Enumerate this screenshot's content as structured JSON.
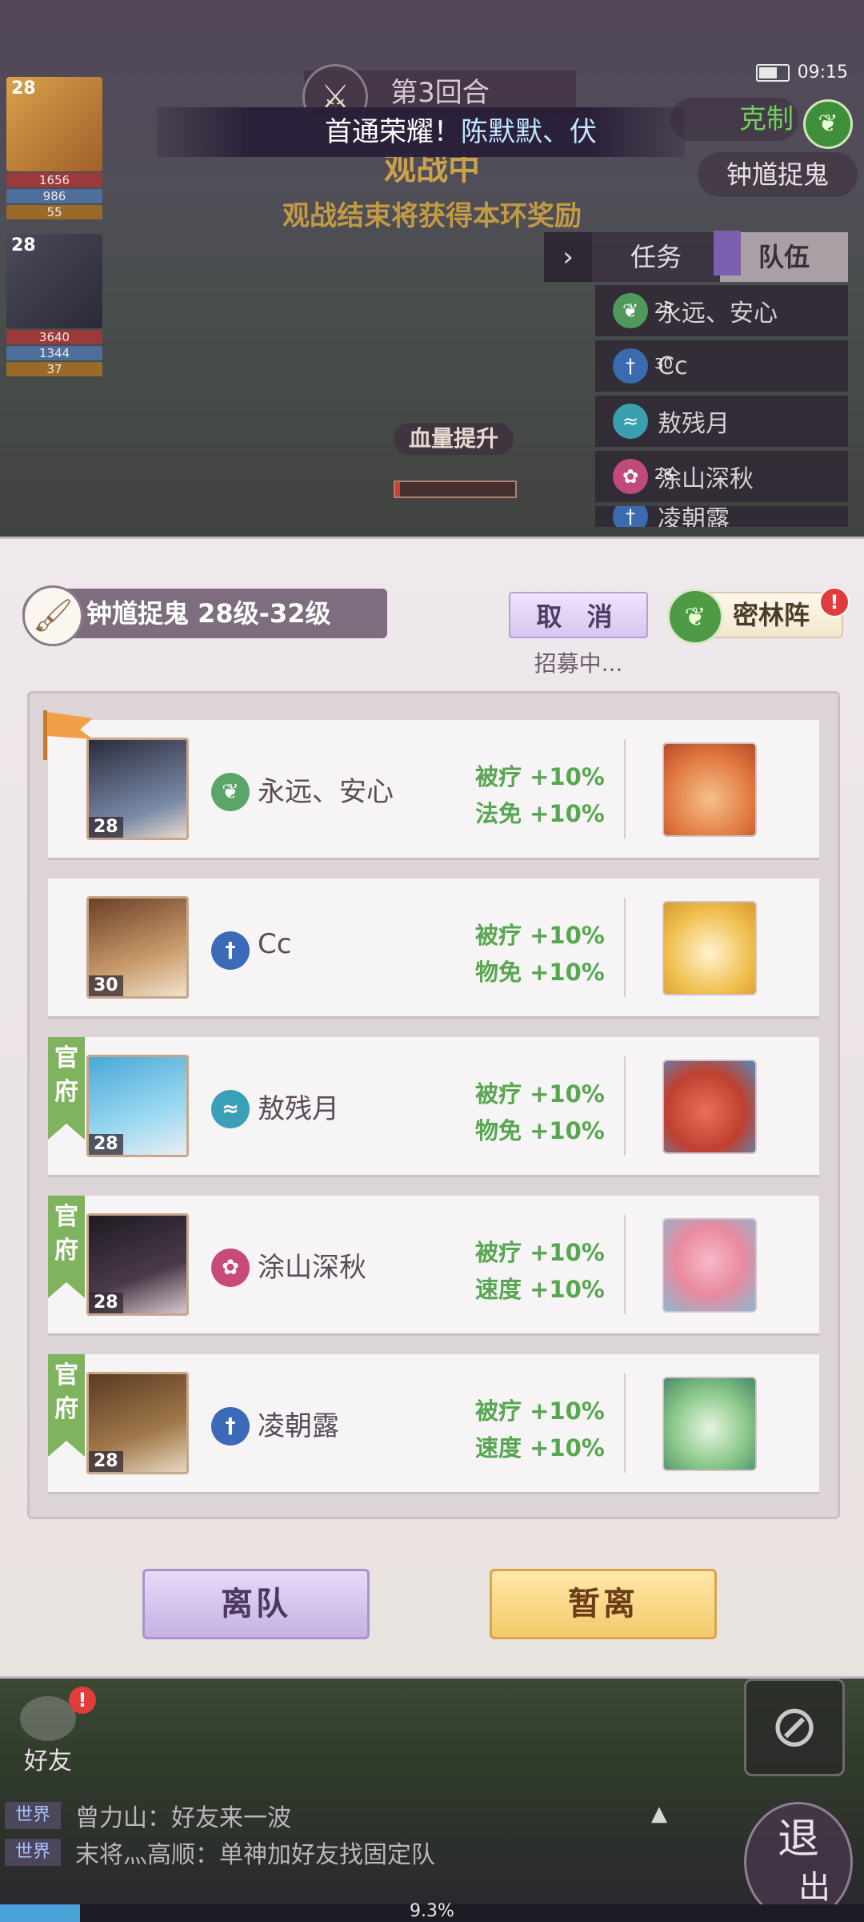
{
  "status": {
    "time": "09:15"
  },
  "battle": {
    "round": "第3回合",
    "honor_prefix": "首通荣耀！",
    "honor_names": "陈默默、伏",
    "spectating": "观战中",
    "spectate_note": "观战结束将获得本环奖励",
    "counter_label": "克制",
    "dungeon_name": "钟馗捉鬼",
    "hp_boost": "血量提升"
  },
  "left_heroes": [
    {
      "level": "28",
      "stats": [
        "1656",
        "986",
        "55"
      ]
    },
    {
      "level": "28",
      "stats": [
        "3640",
        "1344",
        "37"
      ]
    }
  ],
  "side_tabs": {
    "task": "任务",
    "team": "队伍"
  },
  "side_list": [
    {
      "name": "永远、安心",
      "level": "28"
    },
    {
      "name": "Cc",
      "level": "30"
    },
    {
      "name": "敖残月",
      "level": ""
    },
    {
      "name": "涂山深秋",
      "level": "28"
    },
    {
      "name": "凌朝露",
      "level": ""
    }
  ],
  "panel": {
    "team_title": "钟馗捉鬼 28级-32级",
    "cancel_label": "取 消",
    "recruiting_text": "招募中...",
    "formation_label": "密林阵",
    "alert_mark": "!",
    "leave_label": "离队",
    "away_label": "暂离"
  },
  "members": [
    {
      "name": "永远、安心",
      "level": "28",
      "gov": "",
      "bonus1": "被疗 +10%",
      "bonus2": "法免 +10%"
    },
    {
      "name": "Cc",
      "level": "30",
      "gov": "",
      "bonus1": "被疗 +10%",
      "bonus2": "物免 +10%"
    },
    {
      "name": "敖残月",
      "level": "28",
      "gov": "官府",
      "bonus1": "被疗 +10%",
      "bonus2": "物免 +10%"
    },
    {
      "name": "涂山深秋",
      "level": "28",
      "gov": "官府",
      "bonus1": "被疗 +10%",
      "bonus2": "速度 +10%"
    },
    {
      "name": "凌朝露",
      "level": "28",
      "gov": "官府",
      "bonus1": "被疗 +10%",
      "bonus2": "速度 +10%"
    }
  ],
  "bottom": {
    "friends_label": "好友",
    "friends_alert": "!",
    "chat": [
      {
        "channel": "世界",
        "text": "曾力山：好友来一波"
      },
      {
        "channel": "世界",
        "text": "末将灬高顺：单神加好友找固定队"
      }
    ],
    "exit_label_top": "退",
    "exit_label_bottom": "出",
    "exp_percent": "9.3%"
  },
  "colors": {
    "bonus_green": "#57a650",
    "gov_flag_green": "#7fb35e",
    "alert_red": "#e23b3b",
    "leader_flag_orange": "#f0a046"
  }
}
